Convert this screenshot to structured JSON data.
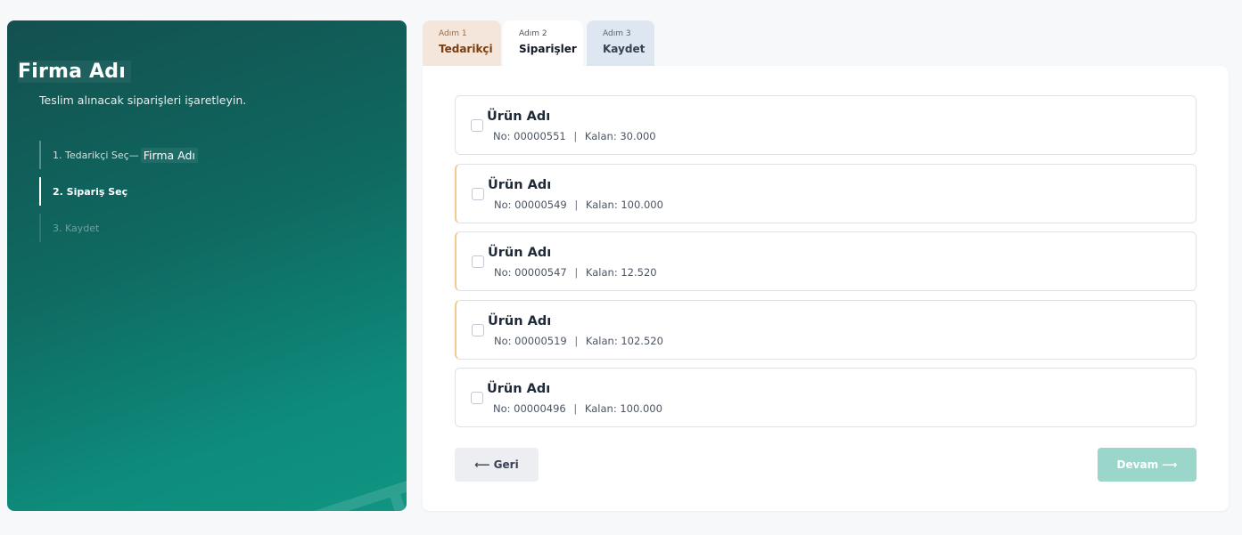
{
  "sidebar": {
    "company_name": "Firma Adı",
    "subtitle": "Teslim alınacak siparişleri işaretleyin.",
    "steps": [
      {
        "label": "1. Tedarikçi Seç",
        "separator": "—",
        "value": "Firma Adı",
        "state": "done"
      },
      {
        "label": "2. Sipariş Seç",
        "state": "active"
      },
      {
        "label": "3. Kaydet",
        "state": "future"
      }
    ]
  },
  "tabs": [
    {
      "step": "Adım 1",
      "title": "Tedarikçi"
    },
    {
      "step": "Adım 2",
      "title": "Siparişler"
    },
    {
      "step": "Adım 3",
      "title": "Kaydet"
    }
  ],
  "orders": [
    {
      "name": "Ürün Adı",
      "no_label": "No:",
      "no": "00000551",
      "sep": "|",
      "remaining_label": "Kalan:",
      "remaining": "30.000",
      "checked": false,
      "highlighted": false
    },
    {
      "name": "Ürün Adı",
      "no_label": "No:",
      "no": "00000549",
      "sep": "|",
      "remaining_label": "Kalan:",
      "remaining": "100.000",
      "checked": false,
      "highlighted": true
    },
    {
      "name": "Ürün Adı",
      "no_label": "No:",
      "no": "00000547",
      "sep": "|",
      "remaining_label": "Kalan:",
      "remaining": "12.520",
      "checked": false,
      "highlighted": true
    },
    {
      "name": "Ürün Adı",
      "no_label": "No:",
      "no": "00000519",
      "sep": "|",
      "remaining_label": "Kalan:",
      "remaining": "102.520",
      "checked": false,
      "highlighted": true
    },
    {
      "name": "Ürün Adı",
      "no_label": "No:",
      "no": "00000496",
      "sep": "|",
      "remaining_label": "Kalan:",
      "remaining": "100.000",
      "checked": false,
      "highlighted": false
    }
  ],
  "buttons": {
    "back": "⟵ Geri",
    "next": "Devam ⟶"
  },
  "colors": {
    "accent": "#0e8c7c",
    "next_button": "#9bd6cb",
    "highlight_border": "#f0c993"
  }
}
